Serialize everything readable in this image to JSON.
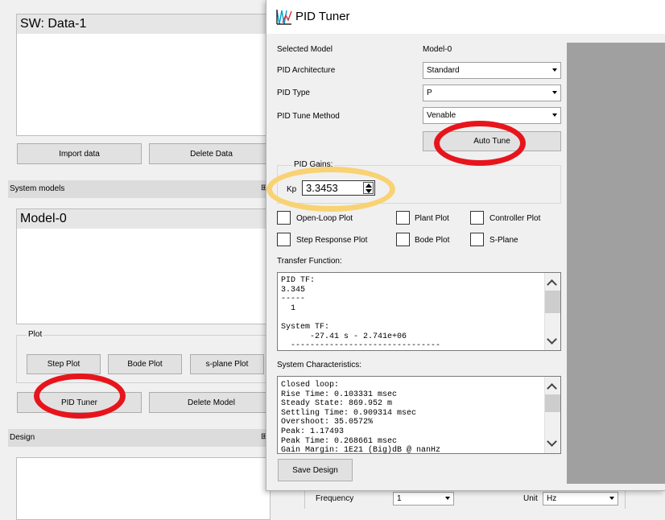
{
  "left": {
    "data_title": "SW: Data-1",
    "import_button": "Import data",
    "delete_data_button": "Delete Data",
    "system_models_label": "System models",
    "model_item": "Model-0",
    "plot_label": "Plot",
    "step_plot_button": "Step Plot",
    "bode_plot_button": "Bode Plot",
    "splane_plot_button": "s-plane Plot",
    "pid_tuner_button": "PID Tuner",
    "delete_model_button": "Delete Model",
    "design_label": "Design"
  },
  "bottom": {
    "frequency_label": "Frequency",
    "frequency_value": "1",
    "unit_label": "Unit",
    "unit_value": "Hz"
  },
  "pid_window": {
    "title": "PID Tuner",
    "selected_model_label": "Selected Model",
    "selected_model_value": "Model-0",
    "architecture_label": "PID Architecture",
    "architecture_value": "Standard",
    "type_label": "PID Type",
    "type_value": "P",
    "tune_method_label": "PID Tune Method",
    "tune_method_value": "Venable",
    "auto_tune_button": "Auto Tune",
    "gains_label": "PID Gains:",
    "kp_label": "Kp",
    "kp_value": "3.3453",
    "checkboxes": {
      "open_loop": "Open-Loop Plot",
      "plant": "Plant Plot",
      "controller": "Controller Plot",
      "step_response": "Step Response Plot",
      "bode": "Bode Plot",
      "splane": "S-Plane"
    },
    "tf_label": "Transfer Function:",
    "tf_lines": [
      "PID TF:",
      "3.345",
      "-----",
      "  1",
      "",
      "System TF:",
      "      -27.41 s - 2.741e+06",
      "  -------------------------------"
    ],
    "sys_label": "System Characteristics:",
    "sys_lines": [
      "Closed loop:",
      "Rise Time: 0.103331 msec",
      "Steady State: 869.952 m",
      "Settling Time: 0.909314 msec",
      "Overshoot: 35.0572%",
      "Peak: 1.17493",
      "Peak Time: 0.268661 msec",
      "Gain Margin: 1E21 (Big)dB @ nanHz"
    ],
    "save_button": "Save Design"
  },
  "colors": {
    "highlight_red": "#e8141c",
    "highlight_yellow": "#f8d273",
    "plot_area_gray": "#a0a0a0"
  }
}
